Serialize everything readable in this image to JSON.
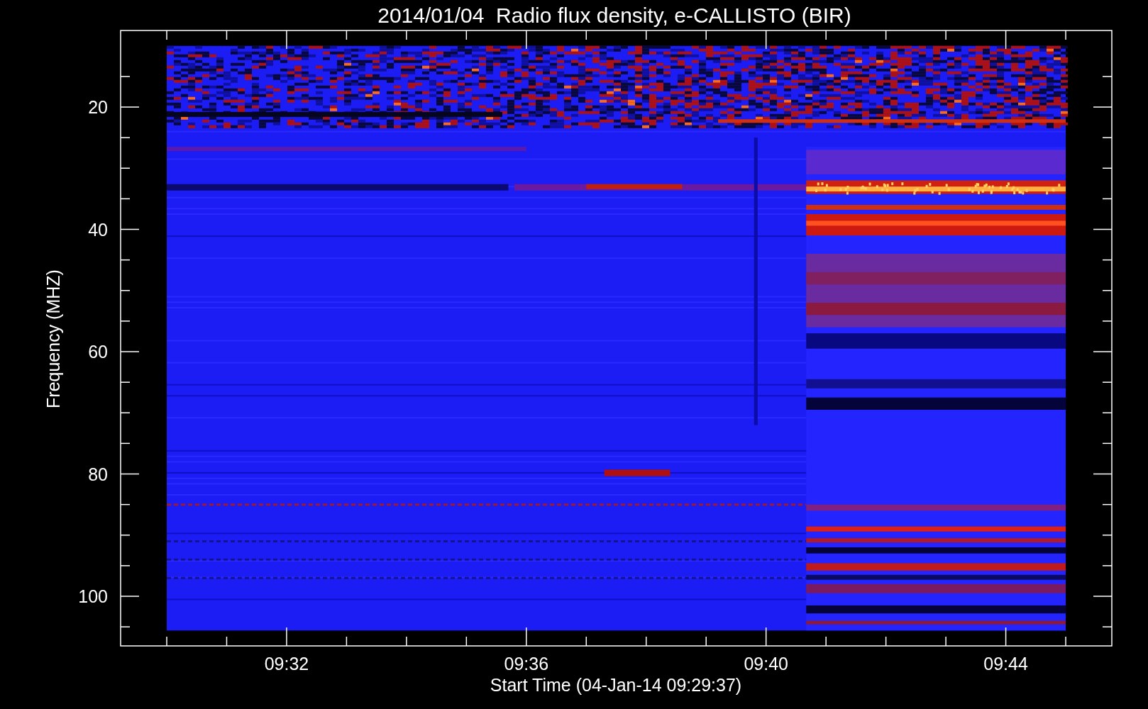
{
  "title": "2014/01/04  Radio flux density, e-CALLISTO (BIR)",
  "y_axis": {
    "label": "Frequency (MHZ)",
    "ticks": [
      "20",
      "40",
      "60",
      "80",
      "100"
    ]
  },
  "x_axis": {
    "label": "Start Time (04-Jan-14 09:29:37)",
    "ticks": [
      "09:32",
      "09:36",
      "09:40",
      "09:44"
    ]
  }
}
